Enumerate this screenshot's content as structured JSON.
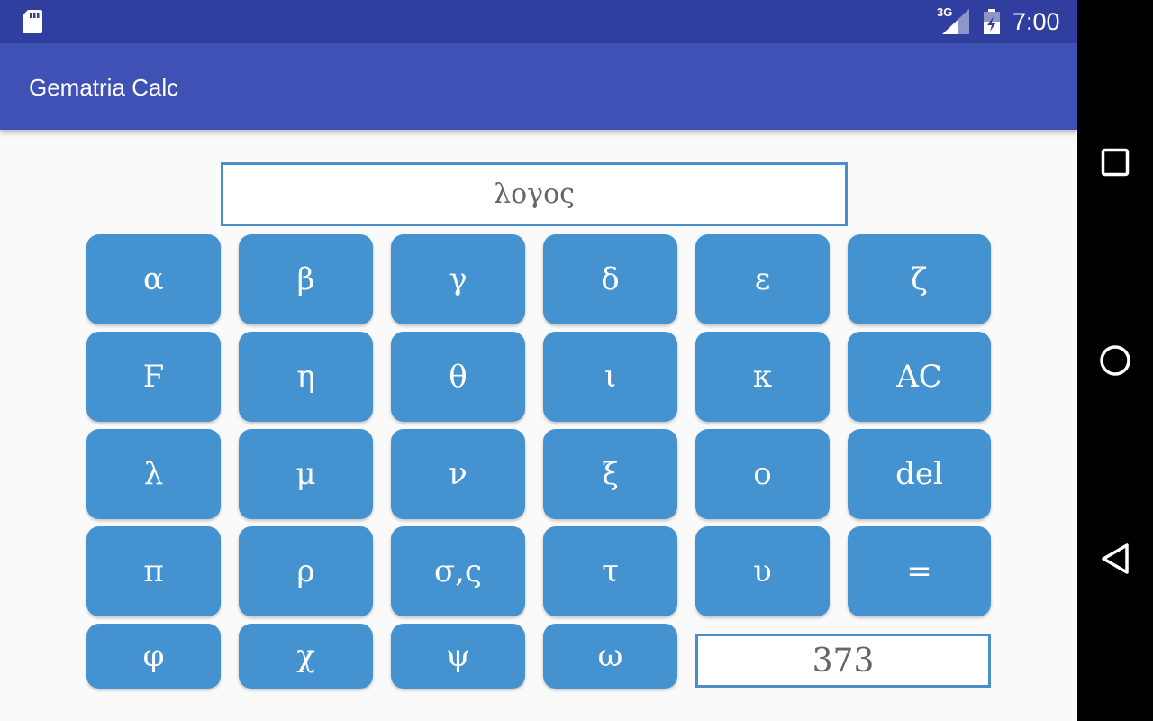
{
  "status_bar": {
    "time": "7:00",
    "network": "3G",
    "icons": [
      "sd-card-icon",
      "signal-icon",
      "battery-charging-icon"
    ]
  },
  "app_bar": {
    "title": "Gematria Calc"
  },
  "word_input": {
    "value": "λογος"
  },
  "keypad": {
    "rows": [
      [
        "α",
        "β",
        "γ",
        "δ",
        "ε",
        "ζ"
      ],
      [
        "Ϝ",
        "η",
        "θ",
        "ι",
        "κ",
        "AC"
      ],
      [
        "λ",
        "μ",
        "ν",
        "ξ",
        "ο",
        "del"
      ],
      [
        "π",
        "ρ",
        "σ,ς",
        "τ",
        "υ",
        "="
      ],
      [
        "φ",
        "χ",
        "ψ",
        "ω"
      ]
    ]
  },
  "result": {
    "value": "373"
  },
  "nav_bar": {
    "buttons": [
      "recents-icon",
      "home-icon",
      "back-icon"
    ]
  },
  "colors": {
    "status_bar": "#303f9f",
    "app_bar": "#3f51b5",
    "key_bg": "#4592d0",
    "field_border": "#4a8fcc"
  }
}
